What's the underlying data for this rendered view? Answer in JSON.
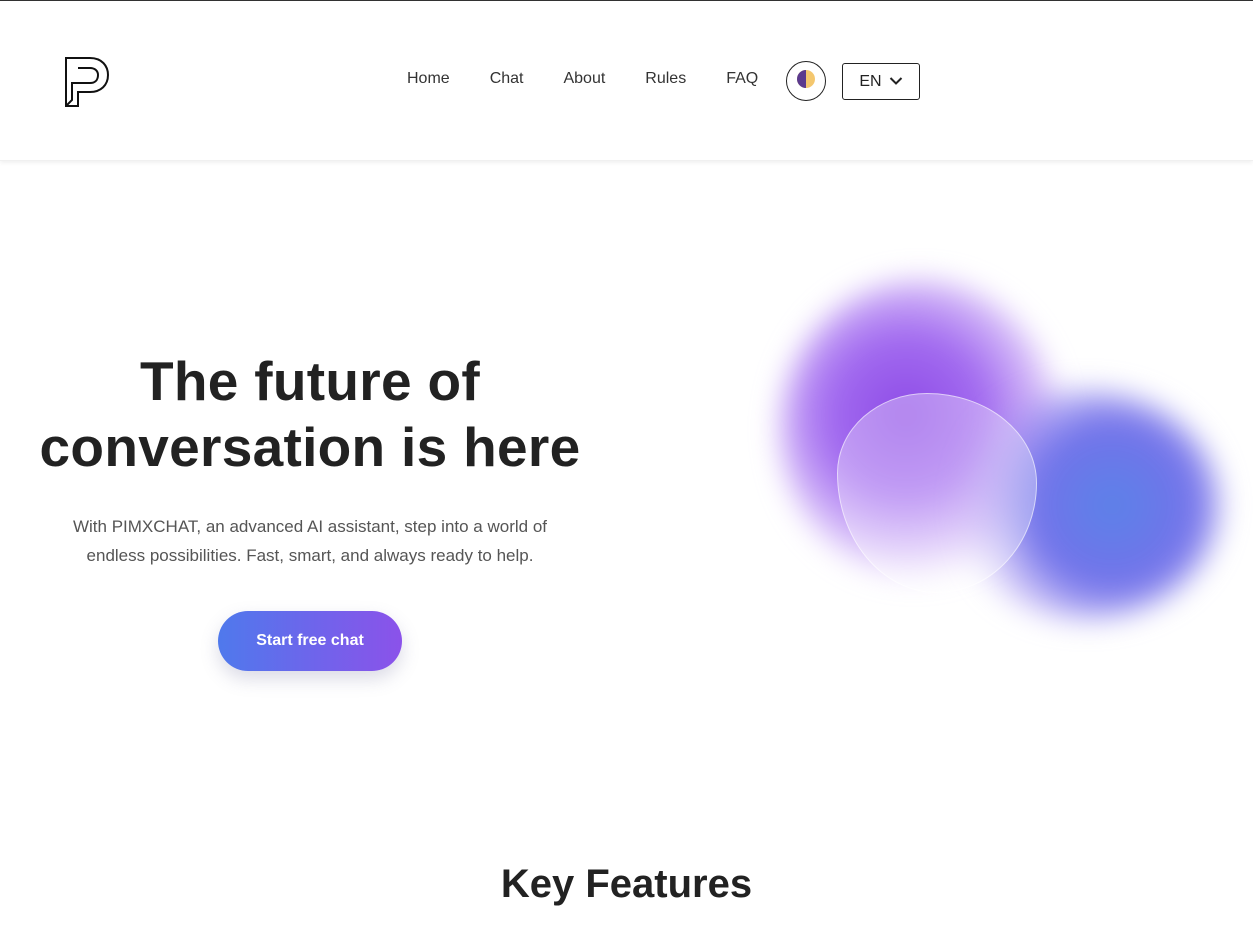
{
  "brand": {
    "logo_icon": "p-letter-logo-icon"
  },
  "nav": {
    "items": [
      {
        "label": "Home"
      },
      {
        "label": "Chat"
      },
      {
        "label": "About"
      },
      {
        "label": "Rules"
      },
      {
        "label": "FAQ"
      }
    ]
  },
  "header_controls": {
    "theme_icon": "half-moon-theme-icon",
    "language": {
      "selected": "EN",
      "icon": "chevron-down-icon"
    }
  },
  "hero": {
    "title_line1": "The future of",
    "title_line2": "conversation is here",
    "subtitle_line1": "With PIMXCHAT, an advanced AI assistant, step into a world of",
    "subtitle_line2": "endless possibilities. Fast, smart, and always ready to help.",
    "cta_label": "Start free chat"
  },
  "features": {
    "title": "Key Features"
  },
  "colors": {
    "gradient_start": "#4f79ec",
    "gradient_end": "#8b52ea",
    "blob_purple": "#8d4ae6",
    "blob_blue": "#5b82e8",
    "theme_icon_dark": "#5b3a8e",
    "theme_icon_light": "#f4c76e"
  }
}
